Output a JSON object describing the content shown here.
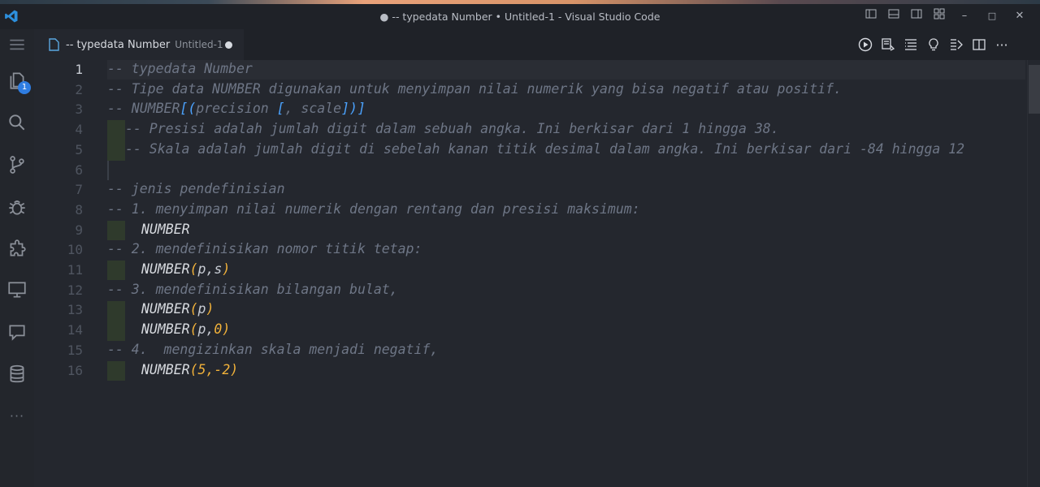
{
  "window": {
    "title": "● -- typedata Number • Untitled-1 - Visual Studio Code"
  },
  "tab": {
    "name": "-- typedata Number",
    "description": "Untitled-1"
  },
  "activity": {
    "explorer_badge": "1",
    "more": "···"
  },
  "window_controls": {
    "minimize": "–",
    "maximize": "□",
    "close": "✕"
  },
  "editor": {
    "active_line": 1,
    "lines": [
      {
        "n": "1"
      },
      {
        "n": "2"
      },
      {
        "n": "3"
      },
      {
        "n": "4"
      },
      {
        "n": "5"
      },
      {
        "n": "6"
      },
      {
        "n": "7"
      },
      {
        "n": "8"
      },
      {
        "n": "9"
      },
      {
        "n": "10"
      },
      {
        "n": "11"
      },
      {
        "n": "12"
      },
      {
        "n": "13"
      },
      {
        "n": "14"
      },
      {
        "n": "15"
      },
      {
        "n": "16"
      }
    ],
    "text": {
      "l1": "-- typedata Number",
      "l2": "-- Tipe data NUMBER digunakan untuk menyimpan nilai numerik yang bisa negatif atau positif.",
      "l3a": "-- NUMBER",
      "l3b": "[",
      "l3c": "(",
      "l3d": "precision ",
      "l3e": "[",
      "l3f": ", scale",
      "l3g": "]",
      "l3h": ")",
      "l3i": "]",
      "l4": "-- Presisi adalah jumlah digit dalam sebuah angka. Ini berkisar dari 1 hingga 38.",
      "l5": "-- Skala adalah jumlah digit di sebelah kanan titik desimal dalam angka. Ini berkisar dari -84 hingga 12",
      "l7": "-- jenis pendefinisian",
      "l8": "-- 1. menyimpan nilai numerik dengan rentang dan presisi maksimum:",
      "l9": "NUMBER",
      "l10": "-- 2. mendefinisikan nomor titik tetap:",
      "l11a": "NUMBER",
      "l11b": "(",
      "l11c": "p,s",
      "l11d": ")",
      "l12": "-- 3. mendefinisikan bilangan bulat,",
      "l13a": "NUMBER",
      "l13b": "(",
      "l13c": "p",
      "l13d": ")",
      "l14a": "NUMBER",
      "l14b": "(",
      "l14c": "p,",
      "l14d": "0",
      "l14e": ")",
      "l15": "-- 4.  mengizinkan skala menjadi negatif,",
      "l16a": "NUMBER",
      "l16b": "(",
      "l16c": "5,-2",
      "l16d": ")"
    }
  },
  "colors": {
    "comment": "#6e7686",
    "bracket_gold": "#f2b23a",
    "bracket_blue": "#4ba3ff",
    "accent": "#2f7de1"
  }
}
